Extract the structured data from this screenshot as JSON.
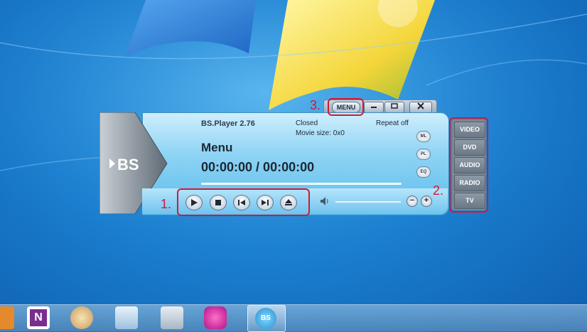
{
  "player": {
    "title": "BS.Player 2.76",
    "status": "Closed",
    "movie_size": "Movie size: 0x0",
    "repeat": "Repeat off",
    "menu_label": "Menu",
    "time": "00:00:00 / 00:00:00",
    "logo_text": "BS",
    "menu_button": "MENU",
    "side_buttons": [
      "ML",
      "PL",
      "EQ"
    ]
  },
  "side_menu": [
    "VIDEO",
    "DVD",
    "AUDIO",
    "RADIO",
    "TV"
  ],
  "annotations": [
    "1.",
    "2.",
    "3."
  ],
  "colors": {
    "accent_red": "#d01a33",
    "panel_blue": "#8ed4f5"
  },
  "taskbar": {
    "icons": [
      "onenote-icon",
      "paint-icon",
      "notepad-icon",
      "calculator-icon",
      "media-icon",
      "bsplayer-icon"
    ],
    "active_label": "BS"
  }
}
